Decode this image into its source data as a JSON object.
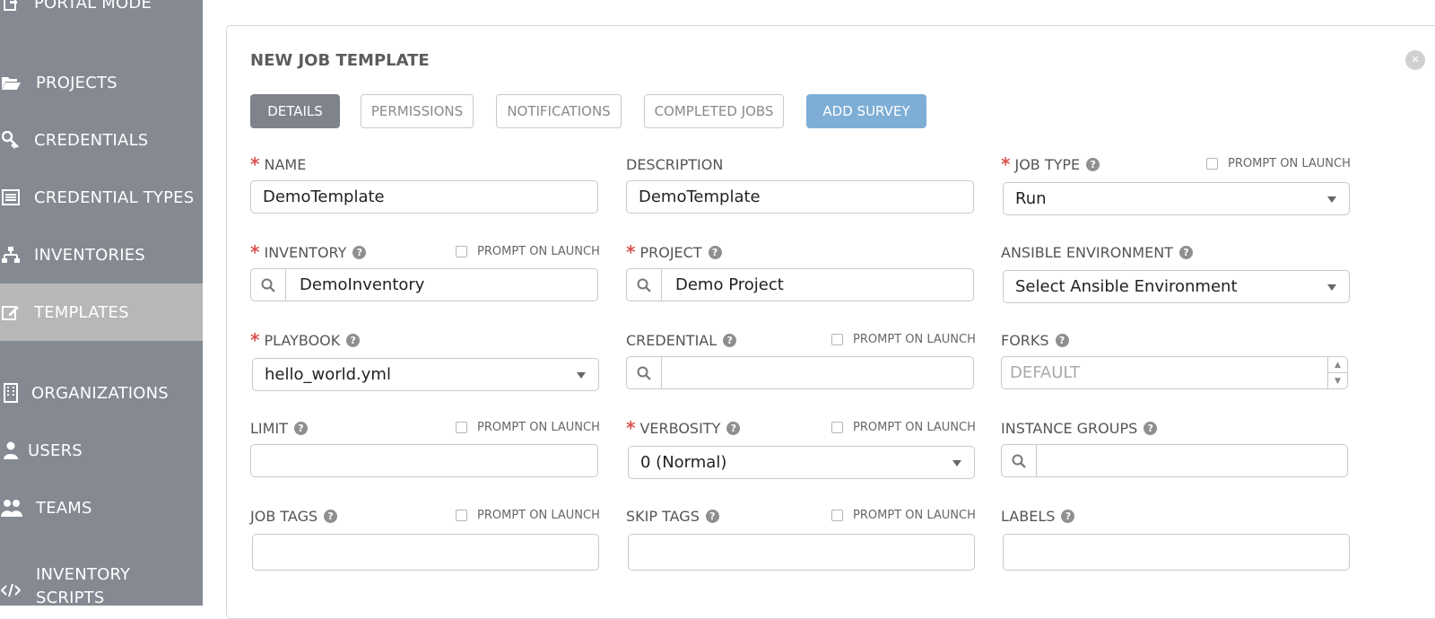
{
  "sidebar": {
    "items": [
      {
        "label": "PORTAL MODE",
        "icon": "portal-icon"
      },
      {
        "label": "PROJECTS",
        "icon": "folder-open-icon"
      },
      {
        "label": "CREDENTIALS",
        "icon": "key-icon"
      },
      {
        "label": "CREDENTIAL TYPES",
        "icon": "list-icon"
      },
      {
        "label": "INVENTORIES",
        "icon": "sitemap-icon"
      },
      {
        "label": "TEMPLATES",
        "icon": "edit-icon",
        "active": true
      },
      {
        "label": "ORGANIZATIONS",
        "icon": "building-icon"
      },
      {
        "label": "USERS",
        "icon": "user-icon"
      },
      {
        "label": "TEAMS",
        "icon": "users-icon"
      },
      {
        "label": "INVENTORY SCRIPTS",
        "icon": "code-icon"
      }
    ]
  },
  "panel": {
    "title": "NEW JOB TEMPLATE",
    "tabs": [
      {
        "label": "DETAILS",
        "active": true
      },
      {
        "label": "PERMISSIONS"
      },
      {
        "label": "NOTIFICATIONS"
      },
      {
        "label": "COMPLETED JOBS"
      },
      {
        "label": "ADD SURVEY"
      }
    ]
  },
  "prompt_label": "PROMPT ON LAUNCH",
  "help_glyph": "?",
  "required_mark": "*",
  "close_glyph": "×",
  "fields": {
    "name": {
      "label": "NAME",
      "value": "DemoTemplate"
    },
    "description": {
      "label": "DESCRIPTION",
      "value": "DemoTemplate"
    },
    "job_type": {
      "label": "JOB TYPE",
      "value": "Run"
    },
    "inventory": {
      "label": "INVENTORY",
      "value": "DemoInventory"
    },
    "project": {
      "label": "PROJECT",
      "value": "Demo Project"
    },
    "ansible_environment": {
      "label": "ANSIBLE ENVIRONMENT",
      "value": "Select Ansible Environment"
    },
    "playbook": {
      "label": "PLAYBOOK",
      "value": "hello_world.yml"
    },
    "credential": {
      "label": "CREDENTIAL",
      "value": ""
    },
    "forks": {
      "label": "FORKS",
      "placeholder": "DEFAULT"
    },
    "limit": {
      "label": "LIMIT",
      "value": ""
    },
    "verbosity": {
      "label": "VERBOSITY",
      "value": "0 (Normal)"
    },
    "instance_groups": {
      "label": "INSTANCE GROUPS",
      "value": ""
    },
    "job_tags": {
      "label": "JOB TAGS",
      "value": ""
    },
    "skip_tags": {
      "label": "SKIP TAGS",
      "value": ""
    },
    "labels": {
      "label": "LABELS",
      "value": ""
    }
  },
  "colors": {
    "sidebar": "#848992",
    "active_nav": "#b7b7b7",
    "active_tab": "#7e838c",
    "survey_button": "#7eaed6",
    "required": "#d9534f"
  }
}
